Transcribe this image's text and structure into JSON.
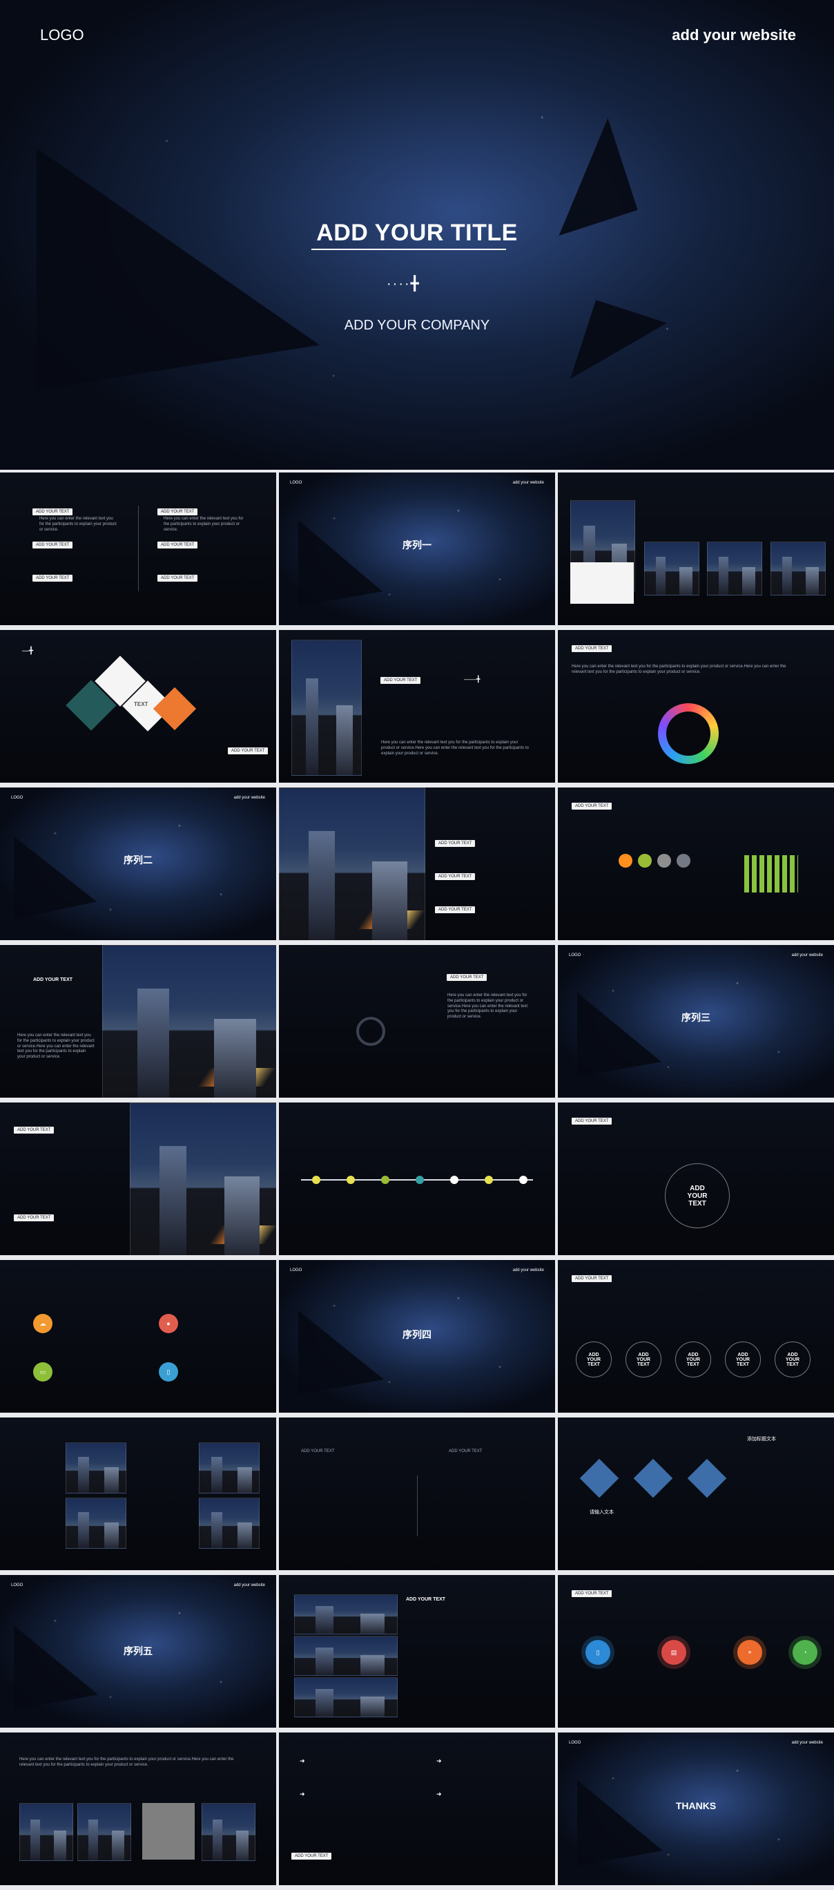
{
  "hero": {
    "logo": "LOGO",
    "website": "add your website",
    "title": "ADD YOUR TITLE",
    "company": "ADD YOUR COMPANY"
  },
  "slides": {
    "section1": "序列一",
    "section2": "序列二",
    "section3": "序列三",
    "section4": "序列四",
    "section5": "序列五",
    "thanks": "THANKS",
    "logo": "LOGO",
    "website": "add your website",
    "add_your_text": "ADD YOUR TEXT",
    "add_your_text_big": "ADD\nYOUR\nTEXT",
    "text_tile": "TEXT",
    "body_text": "Here you can enter the relevant text you for the participants to explain your product or service.",
    "long_body_text": "Here you can enter the relevant text you for the participants to explain your product or service.Here you can enter the relevant text you for the participants to explain your product or service.",
    "cn_title": "请输入文本",
    "cn_subtitle": "请输入文本",
    "cn_top": "添加标题文本"
  }
}
